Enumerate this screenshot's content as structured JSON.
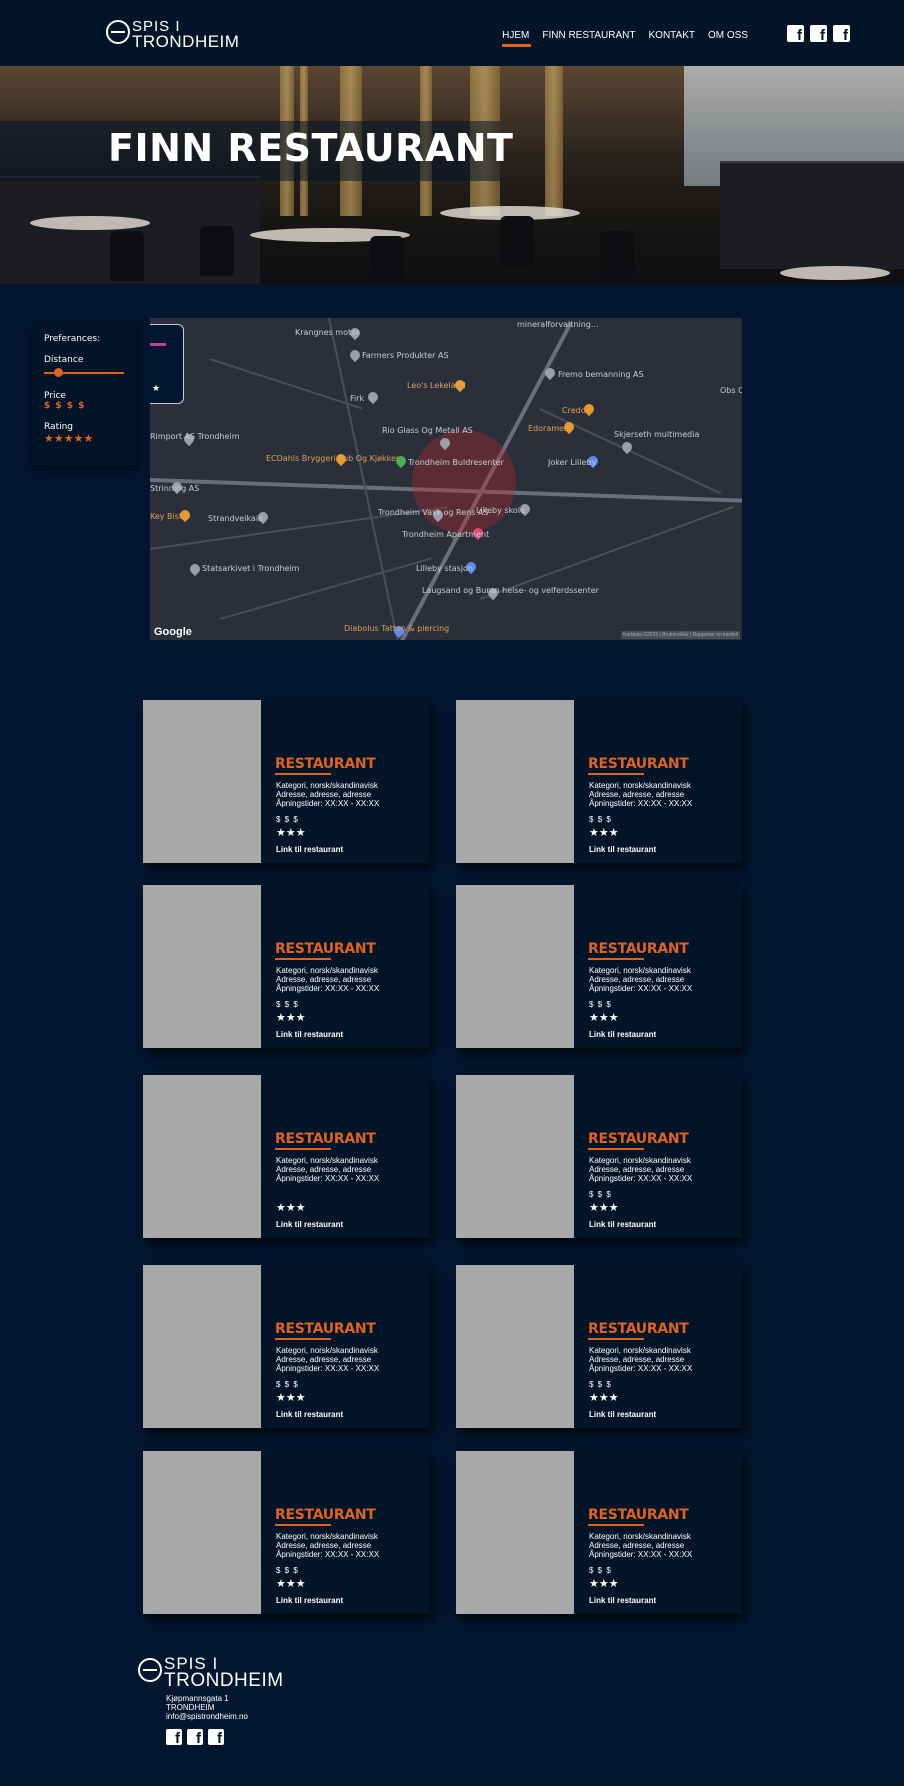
{
  "header": {
    "logo_top": "SPIS I",
    "logo_bottom": "TRONDHEIM",
    "nav": [
      "HJEM",
      "FINN RESTAURANT",
      "KONTAKT",
      "OM OSS"
    ],
    "social_icons": [
      "facebook-icon",
      "facebook-icon",
      "facebook-icon"
    ]
  },
  "hero": {
    "title": "FINN RESTAURANT"
  },
  "preferences": {
    "title": "Preferances:",
    "distance_label": "Distance",
    "distance_value": 0.17,
    "price_label": "Price",
    "price_value": "$ $ $ $",
    "rating_label": "Rating",
    "rating_value": "★★★★★"
  },
  "map": {
    "attribution": "Google",
    "copyright": "Kartdata ©2022 | Brukervilkår | Rapporter en kartfeil",
    "places": [
      "Krangnes motor",
      "mineralforvaltning...",
      "Farmers Produkter AS",
      "Fremo bemanning AS",
      "Leo's Lekeland",
      "Firk",
      "Obs Ci",
      "Credo",
      "Edoramen",
      "Rio Glass Og Metall AS",
      "Skjerseth multimedia",
      "ECDahls Bryggeri Pub Og Kjøkken",
      "Trondheim Buldresenter",
      "Joker Lilleby",
      "Strandveikaia",
      "Lilleby skole",
      "Trondheim Vask og Rens AS",
      "Trondheim Apartment",
      "Lilleby stasjon",
      "Statsarkivet i Trondheim",
      "Laugsand og Buran helse- og velferdssenter",
      "Diabolus Tattoo & piercing",
      "Rimport AS Trondheim",
      "Strinning AS",
      "Key Bistro"
    ]
  },
  "cards": [
    {
      "name": "RESTAURANT",
      "category": "Kategori, norsk/skandinavisk",
      "address": "Adresse, adresse, adresse",
      "hours": "Åpningstider: XX:XX - XX:XX",
      "price": "$ $ $",
      "rating": "★★★",
      "link": "Link til restaurant"
    },
    {
      "name": "RESTAURANT",
      "category": "Kategori, norsk/skandinavisk",
      "address": "Adresse, adresse, adresse",
      "hours": "Åpningstider: XX:XX - XX:XX",
      "price": "$ $ $",
      "rating": "★★★",
      "link": "Link til restaurant"
    },
    {
      "name": "RESTAURANT",
      "category": "Kategori, norsk/skandinavisk",
      "address": "Adresse, adresse, adresse",
      "hours": "Åpningstider: XX:XX - XX:XX",
      "price": "$ $ $",
      "rating": "★★★",
      "link": "Link til restaurant"
    },
    {
      "name": "RESTAURANT",
      "category": "Kategori, norsk/skandinavisk",
      "address": "Adresse, adresse, adresse",
      "hours": "Åpningstider: XX:XX - XX:XX",
      "price": "$ $ $",
      "rating": "★★★",
      "link": "Link til restaurant"
    },
    {
      "name": "RESTAURANT",
      "category": "Kategori, norsk/skandinavisk",
      "address": "Adresse, adresse, adresse",
      "hours": "Åpningstider: XX:XX - XX:XX",
      "price": "",
      "rating": "★★★",
      "link": "Link til restaurant"
    },
    {
      "name": "RESTAURANT",
      "category": "Kategori, norsk/skandinavisk",
      "address": "Adresse, adresse, adresse",
      "hours": "Åpningstider: XX:XX - XX:XX",
      "price": "$ $ $",
      "rating": "★★★",
      "link": "Link til restaurant"
    },
    {
      "name": "RESTAURANT",
      "category": "Kategori, norsk/skandinavisk",
      "address": "Adresse, adresse, adresse",
      "hours": "Åpningstider: XX:XX - XX:XX",
      "price": "$ $ $",
      "rating": "★★★",
      "link": "Link til restaurant"
    },
    {
      "name": "RESTAURANT",
      "category": "Kategori, norsk/skandinavisk",
      "address": "Adresse, adresse, adresse",
      "hours": "Åpningstider: XX:XX - XX:XX",
      "price": "$ $ $",
      "rating": "★★★",
      "link": "Link til restaurant"
    },
    {
      "name": "RESTAURANT",
      "category": "Kategori, norsk/skandinavisk",
      "address": "Adresse, adresse, adresse",
      "hours": "Åpningstider: XX:XX - XX:XX",
      "price": "$ $ $",
      "rating": "★★★",
      "link": "Link til restaurant"
    },
    {
      "name": "RESTAURANT",
      "category": "Kategori, norsk/skandinavisk",
      "address": "Adresse, adresse, adresse",
      "hours": "Åpningstider: XX:XX - XX:XX",
      "price": "$ $ $",
      "rating": "★★★",
      "link": "Link til restaurant"
    }
  ],
  "footer": {
    "logo_top": "SPIS I",
    "logo_bottom": "TRONDHEIM",
    "address_line": "Kjøpmannsgata 1",
    "city": "TRONDHEIM",
    "email": "info@spistrondheim.no",
    "social_icons": [
      "facebook-icon",
      "facebook-icon",
      "facebook-icon"
    ]
  },
  "colors": {
    "background": "#02172f",
    "header": "#021528",
    "accent": "#e0621e",
    "card_image": "#a9a9a9"
  }
}
